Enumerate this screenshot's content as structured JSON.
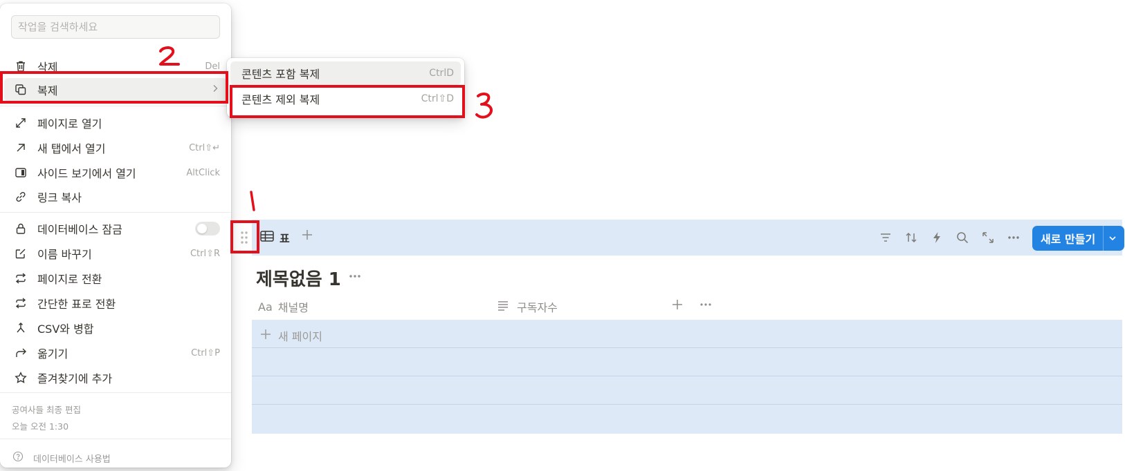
{
  "menu": {
    "search_placeholder": "작업을 검색하세요",
    "items": [
      {
        "label": "삭제",
        "shortcut": "Del",
        "icon": "trash-icon"
      },
      {
        "label": "복제",
        "shortcut": "",
        "icon": "duplicate-icon"
      },
      {
        "label": "페이지로 열기",
        "shortcut": "",
        "icon": "expand-icon"
      },
      {
        "label": "새 탭에서 열기",
        "shortcut": "Ctrl⇧↵",
        "icon": "arrow-up-right-icon"
      },
      {
        "label": "사이드 보기에서 열기",
        "shortcut": "AltClick",
        "icon": "side-peek-icon"
      },
      {
        "label": "링크 복사",
        "shortcut": "",
        "icon": "link-icon"
      },
      {
        "label": "데이터베이스 잠금",
        "shortcut": "",
        "icon": "lock-icon"
      },
      {
        "label": "이름 바꾸기",
        "shortcut": "Ctrl⇧R",
        "icon": "edit-icon"
      },
      {
        "label": "페이지로 전환",
        "shortcut": "",
        "icon": "convert-icon"
      },
      {
        "label": "간단한 표로 전환",
        "shortcut": "",
        "icon": "convert-icon"
      },
      {
        "label": "CSV와 병합",
        "shortcut": "",
        "icon": "merge-icon"
      },
      {
        "label": "옮기기",
        "shortcut": "Ctrl⇧P",
        "icon": "move-icon"
      },
      {
        "label": "즐겨찾기에 추가",
        "shortcut": "",
        "icon": "star-icon"
      }
    ],
    "edited_label": "공여사들 최종 편집",
    "edited_time": "오늘 오전 1:30",
    "help_label": "데이터베이스 사용법"
  },
  "submenu": {
    "items": [
      {
        "label": "콘텐츠 포함 복제",
        "shortcut": "CtrlD"
      },
      {
        "label": "콘텐츠 제외 복제",
        "shortcut": "Ctrl⇧D"
      }
    ]
  },
  "annotations": {
    "one": "1",
    "two": "2",
    "three": "3"
  },
  "database": {
    "view_tab": "표",
    "new_button": "새로 만들기",
    "title": "제목없음 1",
    "columns": [
      {
        "label": "채널명",
        "prefix": "Aa"
      },
      {
        "label": "구독자수"
      }
    ],
    "new_page": "새 페이지"
  },
  "colors": {
    "accent": "#2383e2",
    "highlight": "#dde9f7",
    "annotation_red": "#e3101c"
  }
}
